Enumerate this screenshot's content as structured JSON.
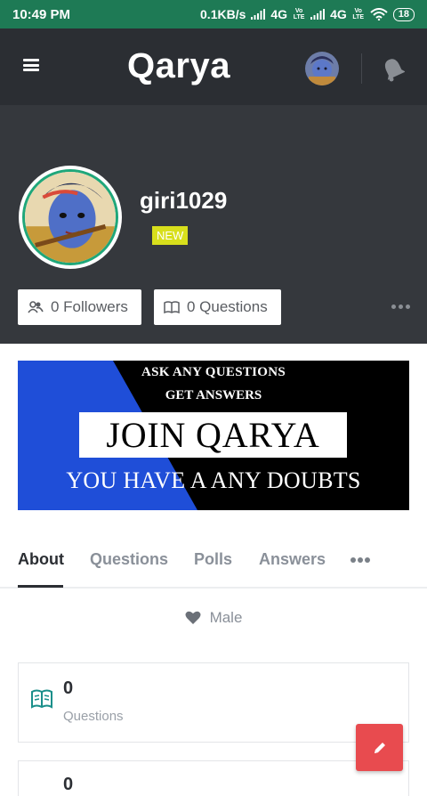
{
  "status_bar": {
    "time": "10:49 PM",
    "network_speed": "0.1KB/s",
    "signal_1": "4G",
    "signal_2": "4G",
    "volte_1": "Vo LTE",
    "volte_2": "Vo LTE",
    "battery": "18",
    "icons": [
      "signal-bars-icon",
      "signal-bars-icon",
      "wifi-icon",
      "battery-icon"
    ]
  },
  "app_bar": {
    "title": "Qarya",
    "icons": [
      "menu-icon",
      "user-avatar",
      "notifications-bell-icon"
    ]
  },
  "profile": {
    "username": "giri1029",
    "badge": "NEW",
    "followers_label": "0 Followers",
    "questions_label": "0 Questions",
    "ring_color": "#1fa77a"
  },
  "banner": {
    "line1": "ASK ANY QUESTIONS",
    "line2": "GET ANSWERS",
    "headline": "JOIN QARYA",
    "line3": "YOU HAVE A ANY DOUBTS",
    "colors": {
      "blue": "#1f4ed8",
      "black": "#000000"
    }
  },
  "tabs": [
    {
      "label": "About",
      "active": true
    },
    {
      "label": "Questions",
      "active": false
    },
    {
      "label": "Polls",
      "active": false
    },
    {
      "label": "Answers",
      "active": false
    }
  ],
  "about": {
    "gender": "Male"
  },
  "stats": [
    {
      "count": "0",
      "label": "Questions",
      "icon": "book-icon"
    },
    {
      "count": "0",
      "label": ""
    }
  ],
  "colors": {
    "status_bar": "#1e7a55",
    "app_bar": "#2b2e33",
    "header": "#35383d",
    "badge": "#d8df1c",
    "fab": "#e84b4f",
    "accent_teal": "#1fa77a"
  }
}
